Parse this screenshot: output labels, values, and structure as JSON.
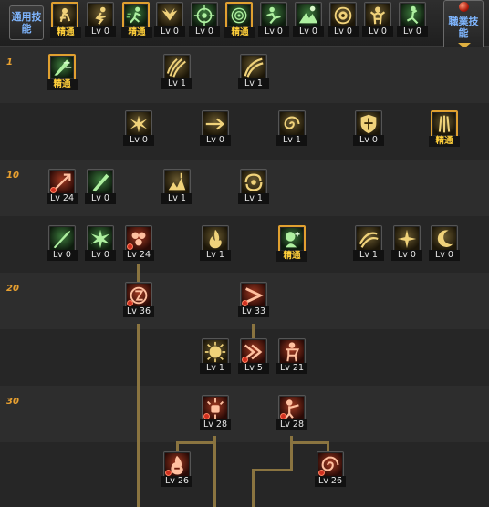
{
  "tabs": {
    "general": {
      "label": "通用技能"
    },
    "profession": {
      "label": "職業技能"
    }
  },
  "row_markers": [
    "1",
    "10",
    "20",
    "30"
  ],
  "labels": {
    "mastery": "精通"
  },
  "top_skills": [
    {
      "name": "top-skill-1",
      "label": "精通",
      "kind": "mastery",
      "theme": "gold",
      "icon": "sit-rest-icon"
    },
    {
      "name": "top-skill-2",
      "label": "Lv 0",
      "kind": "level",
      "theme": "gold",
      "icon": "crouch-stance-icon"
    },
    {
      "name": "top-skill-3",
      "label": "精通",
      "kind": "mastery",
      "theme": "green",
      "icon": "dash-icon"
    },
    {
      "name": "top-skill-4",
      "label": "Lv 0",
      "kind": "level",
      "theme": "gold",
      "icon": "wings-icon"
    },
    {
      "name": "top-skill-5",
      "label": "Lv 0",
      "kind": "level",
      "theme": "green",
      "icon": "crosshair-icon"
    },
    {
      "name": "top-skill-6",
      "label": "精通",
      "kind": "mastery",
      "theme": "green",
      "icon": "target-icon"
    },
    {
      "name": "top-skill-7",
      "label": "Lv 0",
      "kind": "level",
      "theme": "green",
      "icon": "leap-icon"
    },
    {
      "name": "top-skill-8",
      "label": "Lv 0",
      "kind": "level",
      "theme": "green",
      "icon": "mountain-icon"
    },
    {
      "name": "top-skill-9",
      "label": "Lv 0",
      "kind": "level",
      "theme": "gold",
      "icon": "aura-icon"
    },
    {
      "name": "top-skill-10",
      "label": "Lv 0",
      "kind": "level",
      "theme": "gold",
      "icon": "strongman-icon"
    },
    {
      "name": "top-skill-11",
      "label": "Lv 0",
      "kind": "level",
      "theme": "green",
      "icon": "hook-kick-icon"
    }
  ],
  "tree_skills": [
    {
      "name": "skill-r1-1",
      "label": "精通",
      "kind": "mastery",
      "theme": "green",
      "icon": "armor-break-icon"
    },
    {
      "name": "skill-r1-2",
      "label": "Lv 1",
      "kind": "level",
      "theme": "gold",
      "icon": "claw-icon"
    },
    {
      "name": "skill-r1-3",
      "label": "Lv 1",
      "kind": "level",
      "theme": "gold",
      "icon": "slash-icon"
    },
    {
      "name": "skill-r2-1",
      "label": "Lv 0",
      "kind": "level",
      "theme": "gold",
      "icon": "burst-icon"
    },
    {
      "name": "skill-r2-2",
      "label": "Lv 0",
      "kind": "level",
      "theme": "gold",
      "icon": "arrow-icon"
    },
    {
      "name": "skill-r2-3",
      "label": "Lv 1",
      "kind": "level",
      "theme": "gold",
      "icon": "spiral-icon"
    },
    {
      "name": "skill-r2-4",
      "label": "Lv 0",
      "kind": "level",
      "theme": "gold",
      "icon": "shield-icon"
    },
    {
      "name": "skill-r2-5",
      "label": "精通",
      "kind": "mastery",
      "theme": "gold",
      "icon": "triple-blade-icon"
    },
    {
      "name": "skill-r3-1",
      "label": "Lv 24",
      "kind": "level",
      "theme": "red",
      "icon": "thrust-icon"
    },
    {
      "name": "skill-r3-2",
      "label": "Lv 0",
      "kind": "level",
      "theme": "green",
      "icon": "blade-icon"
    },
    {
      "name": "skill-r3-3",
      "label": "Lv 1",
      "kind": "level",
      "theme": "gold",
      "icon": "uppercut-icon"
    },
    {
      "name": "skill-r3-4",
      "label": "Lv 1",
      "kind": "level",
      "theme": "gold",
      "icon": "whirl-icon"
    },
    {
      "name": "skill-r4-1",
      "label": "Lv 0",
      "kind": "level",
      "theme": "green",
      "icon": "sword-icon"
    },
    {
      "name": "skill-r4-2",
      "label": "Lv 0",
      "kind": "level",
      "theme": "green",
      "icon": "spark-icon"
    },
    {
      "name": "skill-r4-3",
      "label": "Lv 24",
      "kind": "level",
      "theme": "red",
      "icon": "cluster-icon"
    },
    {
      "name": "skill-r4-4",
      "label": "Lv 1",
      "kind": "level",
      "theme": "gold",
      "icon": "flame-icon"
    },
    {
      "name": "skill-r4-5",
      "label": "精通",
      "kind": "mastery",
      "theme": "green",
      "icon": "focus-head-icon"
    },
    {
      "name": "skill-r4-6",
      "label": "Lv 1",
      "kind": "level",
      "theme": "gold",
      "icon": "swirl-icon"
    },
    {
      "name": "skill-r4-7",
      "label": "Lv 0",
      "kind": "level",
      "theme": "gold",
      "icon": "cross-star-icon"
    },
    {
      "name": "skill-r4-8",
      "label": "Lv 0",
      "kind": "level",
      "theme": "gold",
      "icon": "crescent-icon"
    },
    {
      "name": "skill-r5-1",
      "label": "Lv 36",
      "kind": "level",
      "theme": "red",
      "icon": "rune-icon"
    },
    {
      "name": "skill-r5-2",
      "label": "Lv 33",
      "kind": "level",
      "theme": "red",
      "icon": "chevron-strike-icon"
    },
    {
      "name": "skill-r6-1",
      "label": "Lv 1",
      "kind": "level",
      "theme": "gold",
      "icon": "sun-face-icon"
    },
    {
      "name": "skill-r6-2",
      "label": "Lv 5",
      "kind": "level",
      "theme": "red",
      "icon": "double-chevron-icon"
    },
    {
      "name": "skill-r6-3",
      "label": "Lv 21",
      "kind": "level",
      "theme": "red",
      "icon": "fighter-icon"
    },
    {
      "name": "skill-r7-1",
      "label": "Lv 28",
      "kind": "level",
      "theme": "red",
      "icon": "fist-burst-icon"
    },
    {
      "name": "skill-r7-2",
      "label": "Lv 28",
      "kind": "level",
      "theme": "red",
      "icon": "punch-icon"
    },
    {
      "name": "skill-r8-1",
      "label": "Lv 26",
      "kind": "level",
      "theme": "red",
      "icon": "fire-kick-icon"
    },
    {
      "name": "skill-r8-2",
      "label": "Lv 26",
      "kind": "level",
      "theme": "red",
      "icon": "vortex-icon"
    }
  ]
}
